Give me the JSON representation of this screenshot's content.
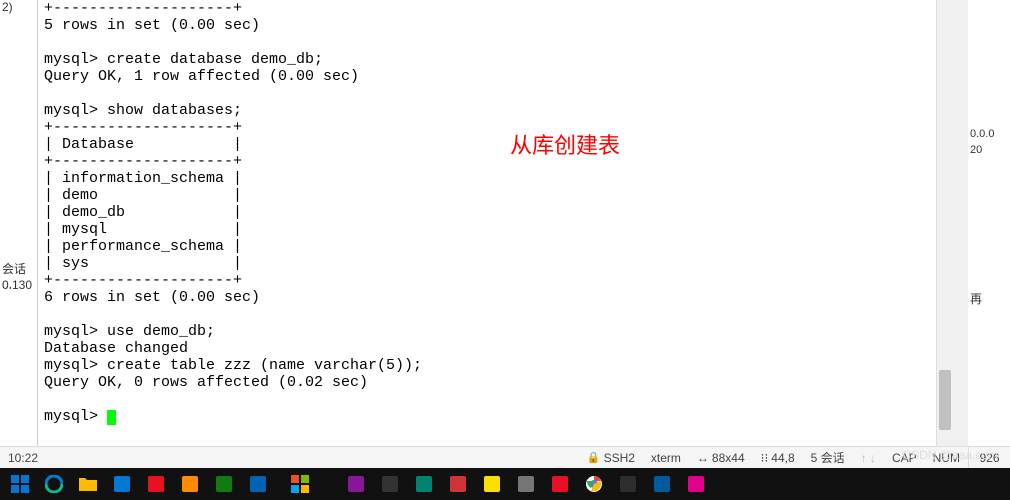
{
  "left": {
    "frag1": "2)",
    "frag2": "会话 ...",
    "frag3": "0.130"
  },
  "terminal": {
    "lines": [
      "+--------------------+",
      "5 rows in set (0.00 sec)",
      "",
      "mysql> create database demo_db;",
      "Query OK, 1 row affected (0.00 sec)",
      "",
      "mysql> show databases;",
      "+--------------------+",
      "| Database           |",
      "+--------------------+",
      "| information_schema |",
      "| demo               |",
      "| demo_db            |",
      "| mysql              |",
      "| performance_schema |",
      "| sys                |",
      "+--------------------+",
      "6 rows in set (0.00 sec)",
      "",
      "mysql> use demo_db;",
      "Database changed",
      "mysql> create table zzz (name varchar(5));",
      "Query OK, 0 rows affected (0.02 sec)",
      "",
      "mysql> "
    ]
  },
  "annotation": "从库创建表",
  "right": {
    "rfrag1": "0.0.0",
    "rfrag2": "20",
    "rfrag3": "再"
  },
  "status": {
    "time": "10:22",
    "ssh": "SSH2",
    "term": "xterm",
    "size": "88x44",
    "pos": "44,8",
    "session": "5 会话",
    "cap": "CAP",
    "num": "NUM"
  },
  "status_right": "926",
  "watermark": "CSDN @aaa.com",
  "taskbar_icons": [
    {
      "name": "windows",
      "color": "#0078d4"
    },
    {
      "name": "edge",
      "color": "#0078d4"
    },
    {
      "name": "folder",
      "color": "#ffb900"
    },
    {
      "name": "vscode",
      "color": "#0078d4"
    },
    {
      "name": "app-red",
      "color": "#e81123"
    },
    {
      "name": "app-orange",
      "color": "#ff8c00"
    },
    {
      "name": "app-green",
      "color": "#107c10"
    },
    {
      "name": "app-blue",
      "color": "#0063b1"
    },
    {
      "name": "app-multi",
      "color": "#ffb900"
    },
    {
      "name": "app-purple",
      "color": "#881798"
    },
    {
      "name": "terminal",
      "color": "#333333"
    },
    {
      "name": "app-teal",
      "color": "#008272"
    },
    {
      "name": "app-red2",
      "color": "#d13438"
    },
    {
      "name": "app-yellow",
      "color": "#fce100"
    },
    {
      "name": "app-grey",
      "color": "#767676"
    },
    {
      "name": "app-red3",
      "color": "#e81123"
    },
    {
      "name": "chrome",
      "color": "#4285f4"
    },
    {
      "name": "app-dark",
      "color": "#2d2d2d"
    },
    {
      "name": "app-blue2",
      "color": "#005a9e"
    },
    {
      "name": "app-pink",
      "color": "#e3008c"
    }
  ]
}
